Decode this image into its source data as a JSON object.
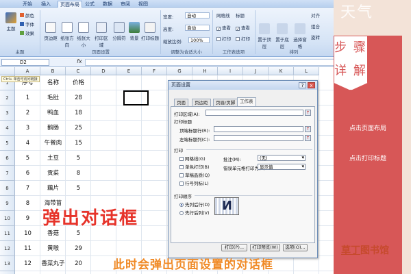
{
  "tabs": [
    "开始",
    "插入",
    "页面布局",
    "公式",
    "数据",
    "审阅",
    "视图"
  ],
  "active_tab": "页面布局",
  "ribbon": {
    "theme_group": {
      "label": "主题",
      "buttons": [
        "主题"
      ],
      "small": [
        "颜色",
        "字体",
        "效果"
      ]
    },
    "page_setup_group": {
      "label": "页面设置",
      "buttons": [
        "页边距",
        "纸张方向",
        "纸张大小",
        "打印区域",
        "分隔符",
        "背景",
        "打印标题"
      ]
    },
    "scale_group": {
      "label": "调整为合适大小",
      "rows": [
        {
          "label": "宽度:",
          "value": "自动"
        },
        {
          "label": "高度:",
          "value": "自动"
        },
        {
          "label": "缩放比例:",
          "value": "100%"
        }
      ]
    },
    "sheet_options_group": {
      "label": "工作表选项",
      "gridlines": {
        "title": "网格线",
        "view": "查看",
        "print": "打印"
      },
      "headings": {
        "title": "标题",
        "view": "查看",
        "print": "打印"
      }
    },
    "arrange_group": {
      "label": "排列",
      "buttons": [
        "置于顶层",
        "置于底层",
        "选择窗格",
        "对齐",
        "组合",
        "旋转"
      ]
    }
  },
  "formula_bar": {
    "name_box": "D2",
    "fx": "fx",
    "formula": ""
  },
  "tooltip": "Ctrl+ 单击可访问链接",
  "sheet": {
    "columns": [
      "A",
      "B",
      "C",
      "D",
      "E",
      "F",
      "G",
      "H",
      "I",
      "J",
      "K",
      "L"
    ],
    "header_row": [
      "序号",
      "名称",
      "价格"
    ],
    "rows": [
      [
        "1",
        "毛肚",
        "28"
      ],
      [
        "2",
        "鸭血",
        "18"
      ],
      [
        "3",
        "鹅肠",
        "25"
      ],
      [
        "4",
        "午餐肉",
        "15"
      ],
      [
        "5",
        "土豆",
        "5"
      ],
      [
        "6",
        "贡菜",
        "8"
      ],
      [
        "7",
        "藕片",
        "5"
      ],
      [
        "8",
        "海带苗",
        ""
      ],
      [
        "9",
        "",
        ""
      ],
      [
        "10",
        "香菇",
        "5"
      ],
      [
        "11",
        "黄喉",
        "29"
      ],
      [
        "12",
        "香菜丸子",
        "20"
      ]
    ],
    "row_numbers": [
      "1",
      "2",
      "3",
      "4",
      "5",
      "6",
      "7",
      "8",
      "9",
      "10",
      "11",
      "12",
      "13",
      "14"
    ]
  },
  "dialog": {
    "title": "页面设置",
    "title_buttons": [
      "?",
      "x"
    ],
    "tabs": [
      "页面",
      "页边距",
      "页眉/页脚",
      "工作表"
    ],
    "active_tab": "工作表",
    "print_area_label": "打印区域(A):",
    "print_titles_label": "打印标题",
    "top_rows_label": "顶端标题行(R):",
    "left_cols_label": "左端标题列(C):",
    "print_label": "打印",
    "checkboxes": [
      "网格线(G)",
      "单色打印(B)",
      "草稿品质(Q)",
      "行号列标(L)"
    ],
    "comments_label": "批注(M):",
    "comments_value": "(无)",
    "errors_label": "错误单元格打印为(E):",
    "errors_value": "显示值",
    "order_label": "打印顺序",
    "order_options": [
      "先列后行(D)",
      "先行后列(V)"
    ],
    "buttons": [
      "打印(P)...",
      "打印预览(W)",
      "选项(O)..."
    ]
  },
  "overlay": {
    "side_heading": "步骤详解",
    "side_heading_lines": [
      "步 骤",
      "详 解"
    ],
    "steps": [
      "点击页面布局",
      "点击打印标题"
    ],
    "watermark": "天气",
    "brand": "草丁图书馆",
    "brand_parts": [
      "草丁",
      "图书馆"
    ],
    "popup_note": "弹出对话框",
    "caption": "此时会弹出页面设置的对话框"
  }
}
